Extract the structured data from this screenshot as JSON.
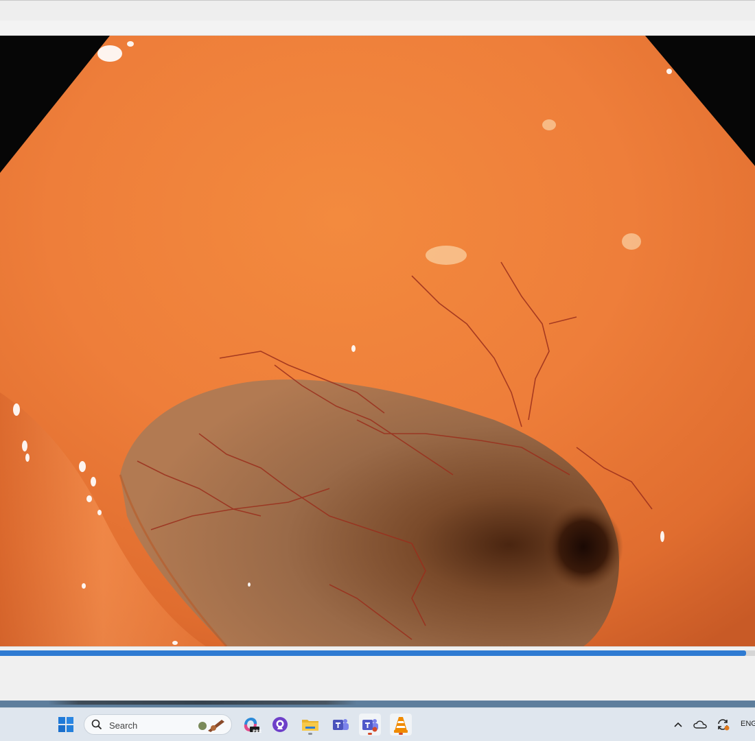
{
  "video": {
    "playback_progress": 0.988
  },
  "taskbar": {
    "search_placeholder": "Search",
    "apps": [
      {
        "name": "start",
        "icon": "windows-logo-icon"
      },
      {
        "name": "copilot",
        "icon": "copilot-icon",
        "badge": "PRE"
      },
      {
        "name": "github",
        "icon": "github-icon"
      },
      {
        "name": "file-explorer",
        "icon": "folder-icon"
      },
      {
        "name": "teams-classic",
        "icon": "teams-icon"
      },
      {
        "name": "teams",
        "icon": "teams-icon"
      },
      {
        "name": "vlc",
        "icon": "vlc-cone-icon"
      }
    ],
    "tray": {
      "language": "ENG"
    }
  },
  "colors": {
    "seek_fill": "#2f7bd2",
    "taskbar_bg": "#dfe6ee"
  }
}
